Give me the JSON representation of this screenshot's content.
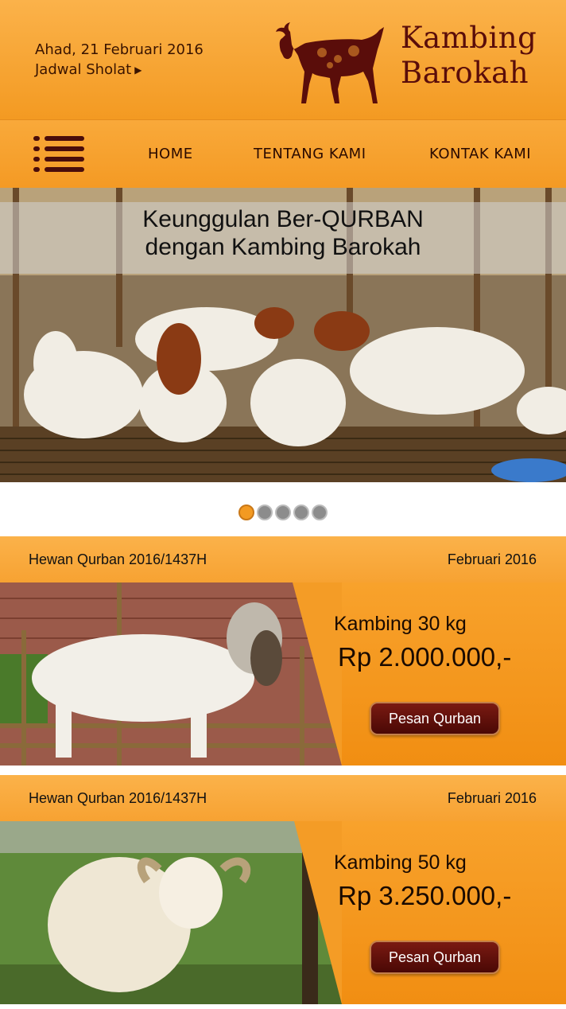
{
  "header": {
    "date": "Ahad, 21 Februari 2016",
    "jadwal_label": "Jadwal Sholat",
    "brand_line1": "Kambing",
    "brand_line2": "Barokah",
    "brand_color": "#5a0d0a"
  },
  "nav": {
    "items": [
      {
        "label": "HOME"
      },
      {
        "label": "TENTANG KAMI"
      },
      {
        "label": "KONTAK KAMI"
      }
    ]
  },
  "hero": {
    "caption_line1": "Keunggulan Ber-QURBAN",
    "caption_line2": "dengan Kambing Barokah"
  },
  "carousel": {
    "total": 5,
    "active_index": 0
  },
  "products": [
    {
      "category": "Hewan Qurban 2016/1437H",
      "date": "Februari 2016",
      "name": "Kambing 30 kg",
      "price": "Rp 2.000.000,-",
      "button": "Pesan Qurban"
    },
    {
      "category": "Hewan Qurban 2016/1437H",
      "date": "Februari 2016",
      "name": "Kambing 50 kg",
      "price": "Rp 3.250.000,-",
      "button": "Pesan Qurban"
    }
  ],
  "colors": {
    "accent": "#f39a22",
    "button": "#5a0d0a"
  }
}
